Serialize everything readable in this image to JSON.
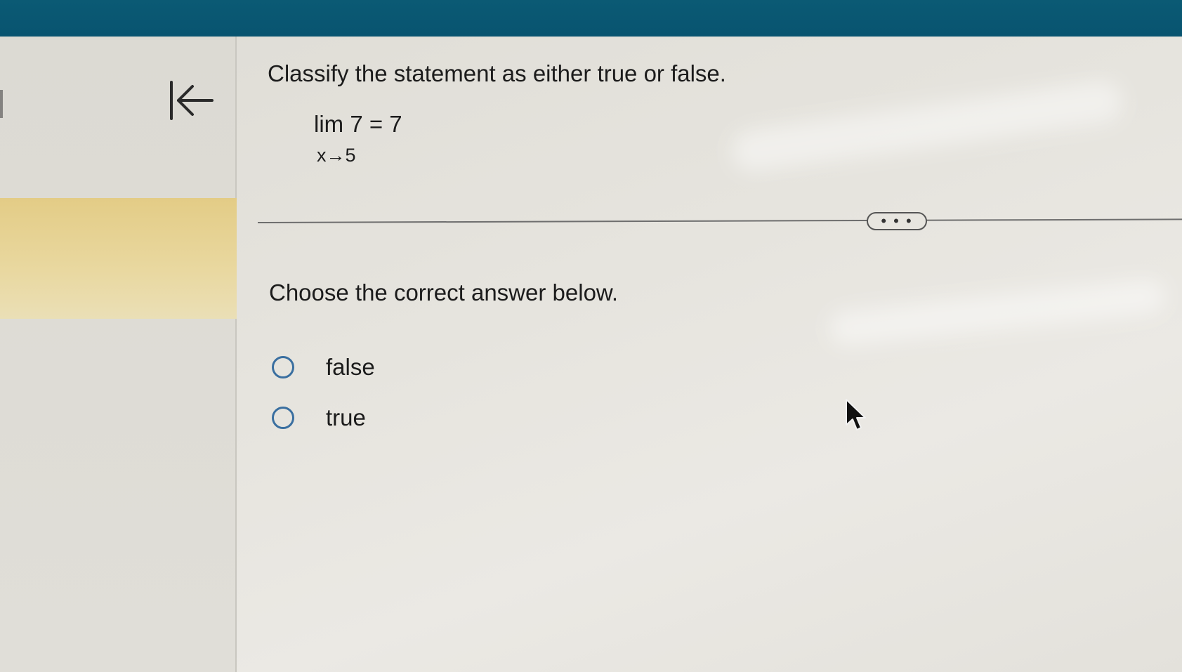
{
  "question": {
    "title": "Classify the statement as either true or false.",
    "limit_expression": "lim 7 = 7",
    "limit_subscript": "x→5"
  },
  "more_button": {
    "label": "• • •"
  },
  "answer": {
    "prompt": "Choose the correct answer below.",
    "options": [
      {
        "label": "false",
        "selected": false
      },
      {
        "label": "true",
        "selected": false
      }
    ]
  },
  "colors": {
    "header": "#0b5a74",
    "sidebar_highlight": "#e3cc86",
    "radio_border": "#3a6fa0",
    "text": "#1c1c1c"
  },
  "icons": {
    "collapse": "collapse-left-icon",
    "cursor": "mouse-pointer-icon"
  }
}
